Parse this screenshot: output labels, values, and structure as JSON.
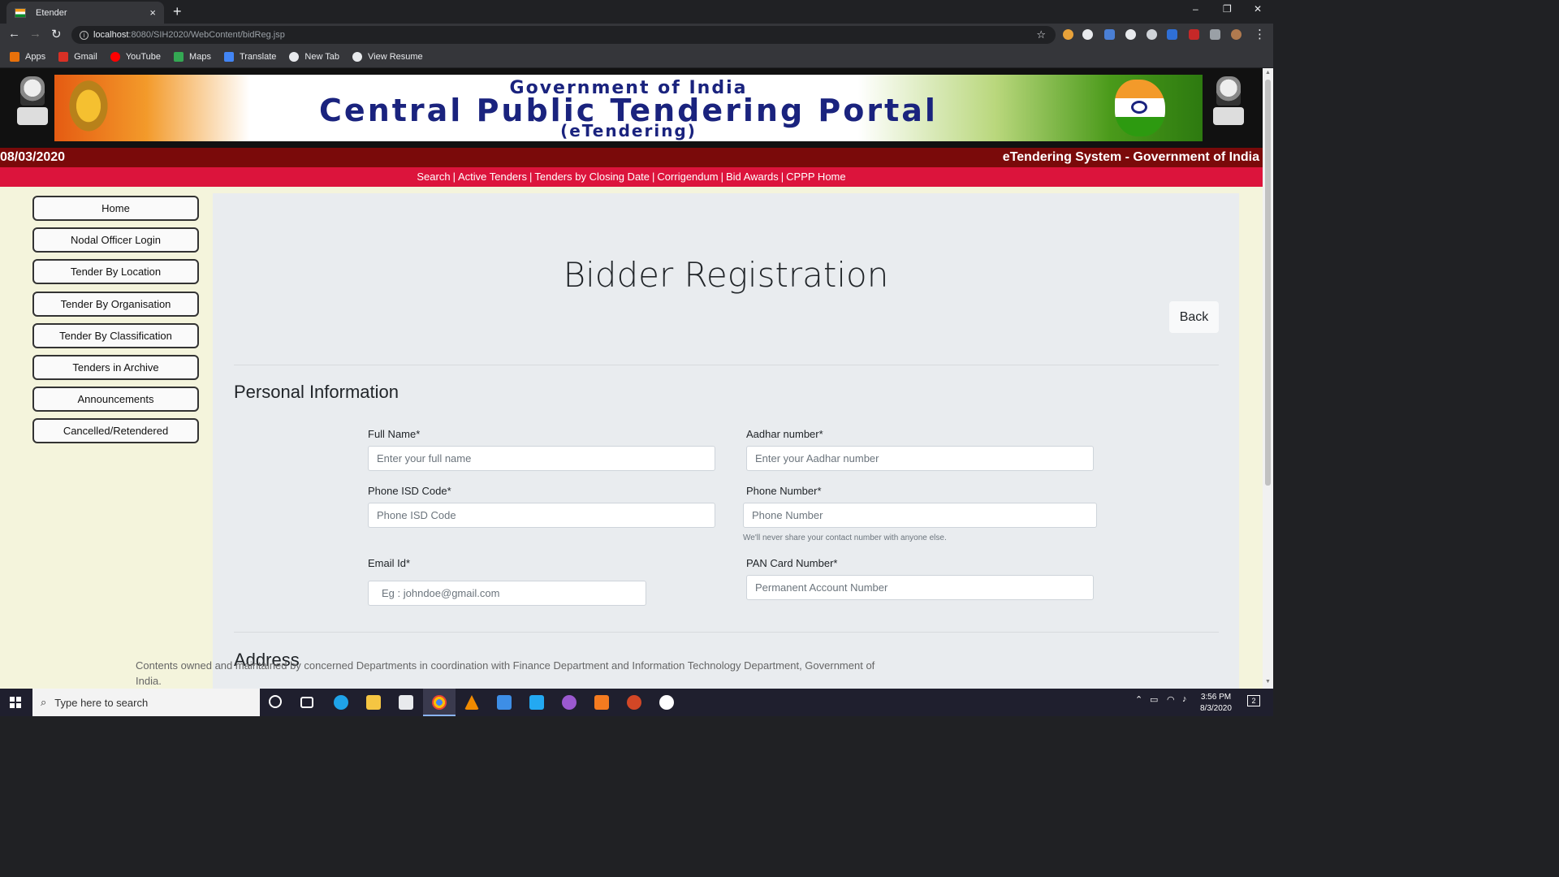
{
  "browser": {
    "tab_title": "Etender",
    "tab_close": "×",
    "new_tab": "+",
    "url_host": "localhost",
    "url_rest": ":8080/SIH2020/WebContent/bidReg.jsp",
    "window_controls": {
      "minimize": "–",
      "restore": "❐",
      "close": "✕"
    },
    "nav": {
      "back": "←",
      "forward": "→",
      "reload": "↻",
      "star": "☆",
      "menu": "⋮"
    },
    "bookmarks": [
      {
        "label": "Apps",
        "icon": "apps-grid-icon",
        "color": "#e8710a"
      },
      {
        "label": "Gmail",
        "icon": "gmail-icon",
        "color": "#d93025"
      },
      {
        "label": "YouTube",
        "icon": "youtube-icon",
        "color": "#ff0000"
      },
      {
        "label": "Maps",
        "icon": "maps-icon",
        "color": "#34a853"
      },
      {
        "label": "Translate",
        "icon": "translate-icon",
        "color": "#4285f4"
      },
      {
        "label": "New Tab",
        "icon": "globe-icon",
        "color": "#e8eaed"
      },
      {
        "label": "View Resume",
        "icon": "globe-icon",
        "color": "#e8eaed"
      }
    ]
  },
  "header": {
    "banner_line1": "Government of India",
    "banner_line2": "Central Public Tendering Portal",
    "banner_line3": "(eTendering)",
    "date": "08/03/2020",
    "system_title": "eTendering System - Government of India",
    "links": [
      "Search",
      "Active Tenders",
      "Tenders by Closing Date",
      "Corrigendum",
      "Bid Awards",
      "CPPP Home"
    ],
    "link_separator": "|"
  },
  "sidebar": {
    "items": [
      "Home",
      "Nodal Officer Login",
      "Tender By Location",
      "Tender By Organisation",
      "Tender By Classification",
      "Tenders in Archive",
      "Announcements",
      "Cancelled/Retendered"
    ]
  },
  "form": {
    "title": "Bidder Registration",
    "back_label": "Back",
    "section_personal": "Personal Information",
    "section_address": "Address",
    "fields": {
      "full_name": {
        "label": "Full Name*",
        "placeholder": "Enter your full name"
      },
      "aadhar": {
        "label": "Aadhar number*",
        "placeholder": "Enter your Aadhar number"
      },
      "isd": {
        "label": "Phone ISD Code*",
        "placeholder": "Phone ISD Code"
      },
      "phone": {
        "label": "Phone Number*",
        "placeholder": "Phone Number",
        "help": "We'll never share your contact number with anyone else."
      },
      "email": {
        "label": "Email Id*",
        "placeholder": "Eg : johndoe@gmail.com"
      },
      "pan": {
        "label": "PAN Card Number*",
        "placeholder": "Permanent Account Number"
      }
    }
  },
  "footer": {
    "text": "Contents owned and maintained by concerned Departments in coordination with Finance Department and Information Technology Department, Government of India."
  },
  "taskbar": {
    "search_placeholder": "Type here to search",
    "time": "3:56 PM",
    "date": "8/3/2020",
    "notification_count": "2"
  }
}
